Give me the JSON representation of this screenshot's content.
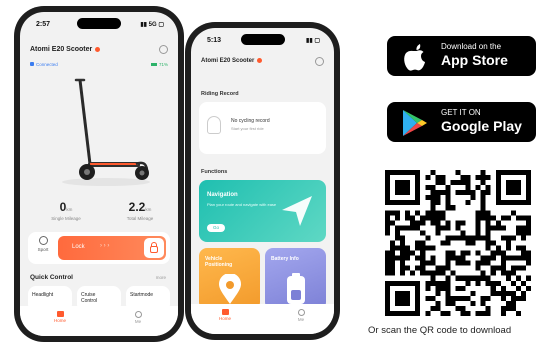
{
  "phone1": {
    "status_time": "2:57",
    "status_right": "▮▮ 5G ▢",
    "title": "Atomi E20 Scooter",
    "connected_label": "Connected",
    "battery_label": "71%",
    "single_mileage_value": "0",
    "single_mileage_unit": "km",
    "single_mileage_label": "Single Mileage",
    "total_mileage_value": "2.2",
    "total_mileage_unit": "km",
    "total_mileage_label": "Total Mileage",
    "mode_label": "Sport",
    "lock_label": "Lock",
    "quick_control_title": "Quick Control",
    "quick_control_more": "more",
    "headlight_label": "Headlight",
    "cruise_control_label": "Cruise Control",
    "start_mode_label": "Startmode",
    "tab_home": "Home",
    "tab_me": "Me"
  },
  "phone2": {
    "status_time": "5:13",
    "status_right": "▮▮ ▢",
    "title": "Atomi E20 Scooter",
    "riding_record_title": "Riding Record",
    "no_record_label": "No cycling record",
    "no_record_sub": "Start your first ride",
    "functions_title": "Functions",
    "navigation_label": "Navigation",
    "navigation_sub": "Plan your route and navigate with ease",
    "navigation_button": "Go",
    "vehicle_positioning_label": "Vehicle Positioning",
    "battery_info_label": "Battery Info",
    "tab_home": "Home",
    "tab_me": "Me"
  },
  "app_store": {
    "line1": "Download on the",
    "line2": "App Store"
  },
  "google_play": {
    "line1": "GET IT ON",
    "line2": "Google Play"
  },
  "qr_caption": "Or scan the QR code to download",
  "colors": {
    "accent": "#ff5a2e",
    "teal": "#1fbfb0",
    "orange_card": "#f7a531",
    "purple_card": "#8a8ee0"
  }
}
